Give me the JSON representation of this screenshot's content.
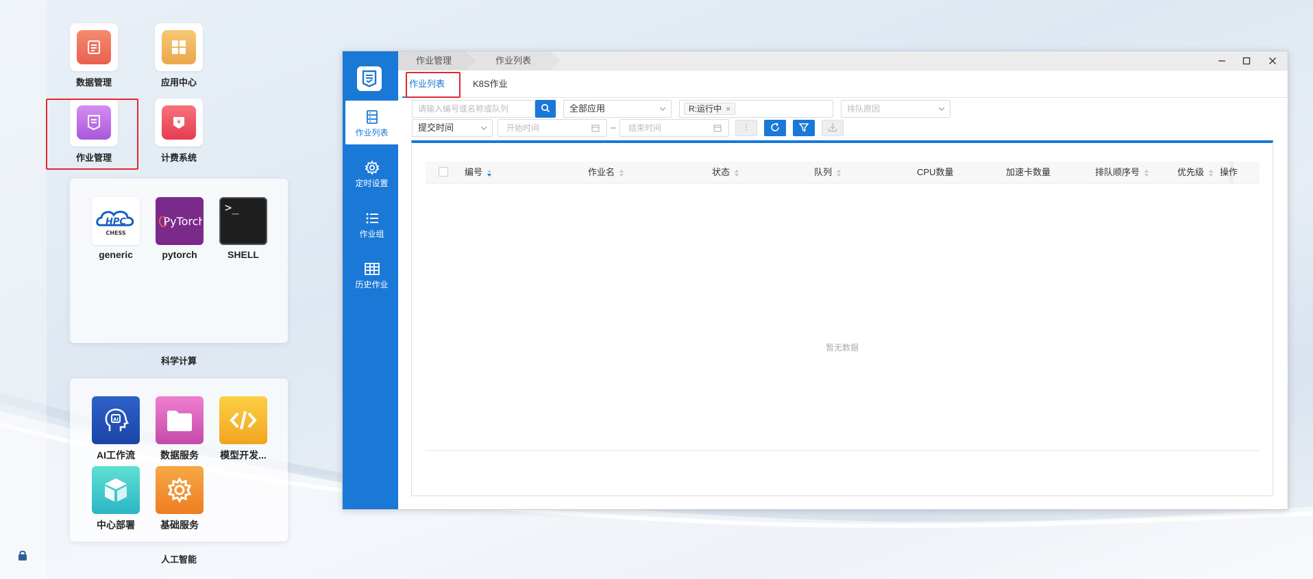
{
  "desktop": {
    "icons": [
      {
        "label": "数据管理",
        "icon": "document-list-icon",
        "color": "#ee6f5a"
      },
      {
        "label": "应用中心",
        "icon": "grid-apps-icon",
        "color": "#f0b450"
      },
      {
        "label": "作业管理",
        "icon": "job-clipboard-icon",
        "color": "#b565e0"
      },
      {
        "label": "计费系统",
        "icon": "billing-yen-icon",
        "color": "#ee4d5f"
      }
    ],
    "sci_panel": {
      "caption": "科学计算",
      "apps": [
        {
          "label": "generic",
          "icon": "hpc-chess-logo-icon",
          "logo_text": "CHESS"
        },
        {
          "label": "pytorch",
          "icon": "pytorch-logo-icon",
          "logo_text": "PyTorch"
        },
        {
          "label": "SHELL",
          "icon": "terminal-icon",
          "logo_text": ">_"
        }
      ]
    },
    "ai_panel": {
      "caption": "人工智能",
      "apps": [
        {
          "label": "AI工作流",
          "icon": "ai-head-icon"
        },
        {
          "label": "数据服务",
          "icon": "folder-icon"
        },
        {
          "label": "模型开发...",
          "icon": "code-brackets-icon"
        },
        {
          "label": "中心部署",
          "icon": "cube-icon"
        },
        {
          "label": "基础服务",
          "icon": "gear-icon"
        }
      ]
    },
    "lock_icon": "lock-icon"
  },
  "window": {
    "breadcrumb": [
      "作业管理",
      "作业列表"
    ],
    "controls": [
      "minimize-icon",
      "maximize-icon",
      "close-icon"
    ],
    "sidebar": [
      {
        "label": "作业列表",
        "icon": "server-list-icon",
        "active": true
      },
      {
        "label": "定时设置",
        "icon": "gear-icon",
        "active": false
      },
      {
        "label": "作业组",
        "icon": "list-icon",
        "active": false
      },
      {
        "label": "历史作业",
        "icon": "table-grid-icon",
        "active": false
      }
    ],
    "tabs": [
      {
        "label": "作业列表",
        "active": true
      },
      {
        "label": "K8S作业",
        "active": false
      }
    ],
    "filters": {
      "search_placeholder": "请输入编号或名称或队列",
      "app_select": "全部应用",
      "status_tag": "R:运行中",
      "queue_reason_placeholder": "排队原因",
      "time_select": "提交时间",
      "start_placeholder": "开始时间",
      "range_sep": "--",
      "end_placeholder": "结束时间"
    },
    "table": {
      "columns": [
        "编号",
        "作业名",
        "状态",
        "队列",
        "CPU数量",
        "加速卡数量",
        "排队顺序号",
        "优先级",
        "操作"
      ],
      "empty_text": "暂无数据"
    },
    "accent": "#1a78d6"
  }
}
